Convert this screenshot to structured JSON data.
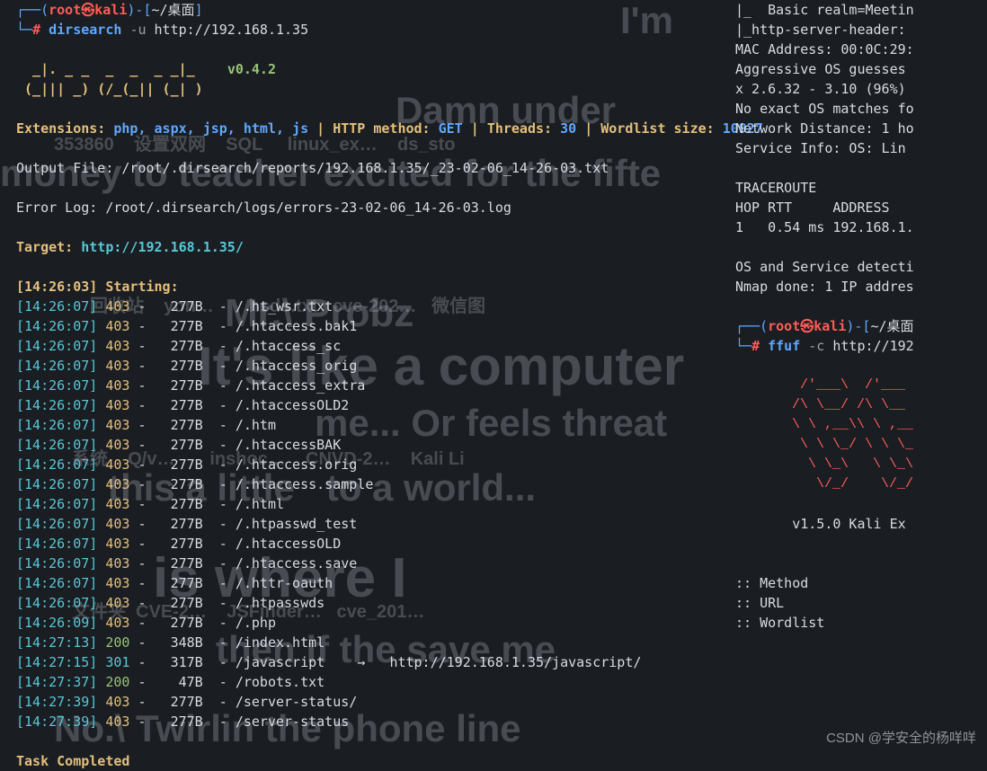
{
  "prompt": {
    "user": "root",
    "at": "㉿",
    "host": "kali",
    "path": "~/桌面",
    "hash": "#",
    "cmd": "dirsearch",
    "flag": "-u",
    "url": "http://192.168.1.35"
  },
  "banner_version": "v0.4.2",
  "header": {
    "ext_key": "Extensions:",
    "ext_val": "php, aspx, jsp, html, js",
    "sep": "|",
    "method_key": "HTTP method:",
    "method_val": "GET",
    "threads_key": "Threads:",
    "threads_val": "30",
    "wordlist_key": "Wordlist size:",
    "wordlist_val": "10927"
  },
  "output_file_key": "Output File:",
  "output_file_val": "/root/.dirsearch/reports/192.168.1.35/_23-02-06_14-26-03.txt",
  "error_log_key": "Error Log:",
  "error_log_val": "/root/.dirsearch/logs/errors-23-02-06_14-26-03.log",
  "target_key": "Target:",
  "target_val": "http://192.168.1.35/",
  "start_time": "[14:26:03]",
  "start_label": "Starting:",
  "entries": [
    {
      "time": "[14:26:07]",
      "status": "403",
      "size": "277B",
      "path": "/.ht_wsr.txt",
      "redirect": ""
    },
    {
      "time": "[14:26:07]",
      "status": "403",
      "size": "277B",
      "path": "/.htaccess.bak1",
      "redirect": ""
    },
    {
      "time": "[14:26:07]",
      "status": "403",
      "size": "277B",
      "path": "/.htaccess_sc",
      "redirect": ""
    },
    {
      "time": "[14:26:07]",
      "status": "403",
      "size": "277B",
      "path": "/.htaccess_orig",
      "redirect": ""
    },
    {
      "time": "[14:26:07]",
      "status": "403",
      "size": "277B",
      "path": "/.htaccess_extra",
      "redirect": ""
    },
    {
      "time": "[14:26:07]",
      "status": "403",
      "size": "277B",
      "path": "/.htaccessOLD2",
      "redirect": ""
    },
    {
      "time": "[14:26:07]",
      "status": "403",
      "size": "277B",
      "path": "/.htm",
      "redirect": ""
    },
    {
      "time": "[14:26:07]",
      "status": "403",
      "size": "277B",
      "path": "/.htaccessBAK",
      "redirect": ""
    },
    {
      "time": "[14:26:07]",
      "status": "403",
      "size": "277B",
      "path": "/.htaccess.orig",
      "redirect": ""
    },
    {
      "time": "[14:26:07]",
      "status": "403",
      "size": "277B",
      "path": "/.htaccess.sample",
      "redirect": ""
    },
    {
      "time": "[14:26:07]",
      "status": "403",
      "size": "277B",
      "path": "/.html",
      "redirect": ""
    },
    {
      "time": "[14:26:07]",
      "status": "403",
      "size": "277B",
      "path": "/.htpasswd_test",
      "redirect": ""
    },
    {
      "time": "[14:26:07]",
      "status": "403",
      "size": "277B",
      "path": "/.htaccessOLD",
      "redirect": ""
    },
    {
      "time": "[14:26:07]",
      "status": "403",
      "size": "277B",
      "path": "/.htaccess.save",
      "redirect": ""
    },
    {
      "time": "[14:26:07]",
      "status": "403",
      "size": "277B",
      "path": "/.httr-oauth",
      "redirect": ""
    },
    {
      "time": "[14:26:07]",
      "status": "403",
      "size": "277B",
      "path": "/.htpasswds",
      "redirect": ""
    },
    {
      "time": "[14:26:09]",
      "status": "403",
      "size": "277B",
      "path": "/.php",
      "redirect": ""
    },
    {
      "time": "[14:27:13]",
      "status": "200",
      "size": "348B",
      "path": "/index.html",
      "redirect": ""
    },
    {
      "time": "[14:27:15]",
      "status": "301",
      "size": "317B",
      "path": "/javascript",
      "redirect": "http://192.168.1.35/javascript/"
    },
    {
      "time": "[14:27:37]",
      "status": "200",
      "size": "47B",
      "path": "/robots.txt",
      "redirect": ""
    },
    {
      "time": "[14:27:39]",
      "status": "403",
      "size": "277B",
      "path": "/server-status/",
      "redirect": ""
    },
    {
      "time": "[14:27:39]",
      "status": "403",
      "size": "277B",
      "path": "/server-status",
      "redirect": ""
    }
  ],
  "completed": "Task Completed",
  "right_panel": {
    "lines": [
      "|_  Basic realm=Meetin",
      "|_http-server-header:",
      "MAC Address: 00:0C:29:",
      "Aggressive OS guesses",
      "x 2.6.32 - 3.10 (96%)",
      "No exact OS matches fo",
      "Network Distance: 1 ho",
      "Service Info: OS: Lin",
      "",
      "TRACEROUTE",
      "HOP RTT     ADDRESS",
      "1   0.54 ms 192.168.1.",
      "",
      "OS and Service detecti",
      "Nmap done: 1 IP addres"
    ],
    "prompt2_path": "~/桌面",
    "prompt2_cmd": "http://192",
    "ffuf_version": "v1.5.0 Kali Ex",
    "footer": [
      ":: Method",
      ":: URL",
      ":: Wordlist"
    ]
  },
  "watermark": "CSDN @学安全的杨咩咩"
}
